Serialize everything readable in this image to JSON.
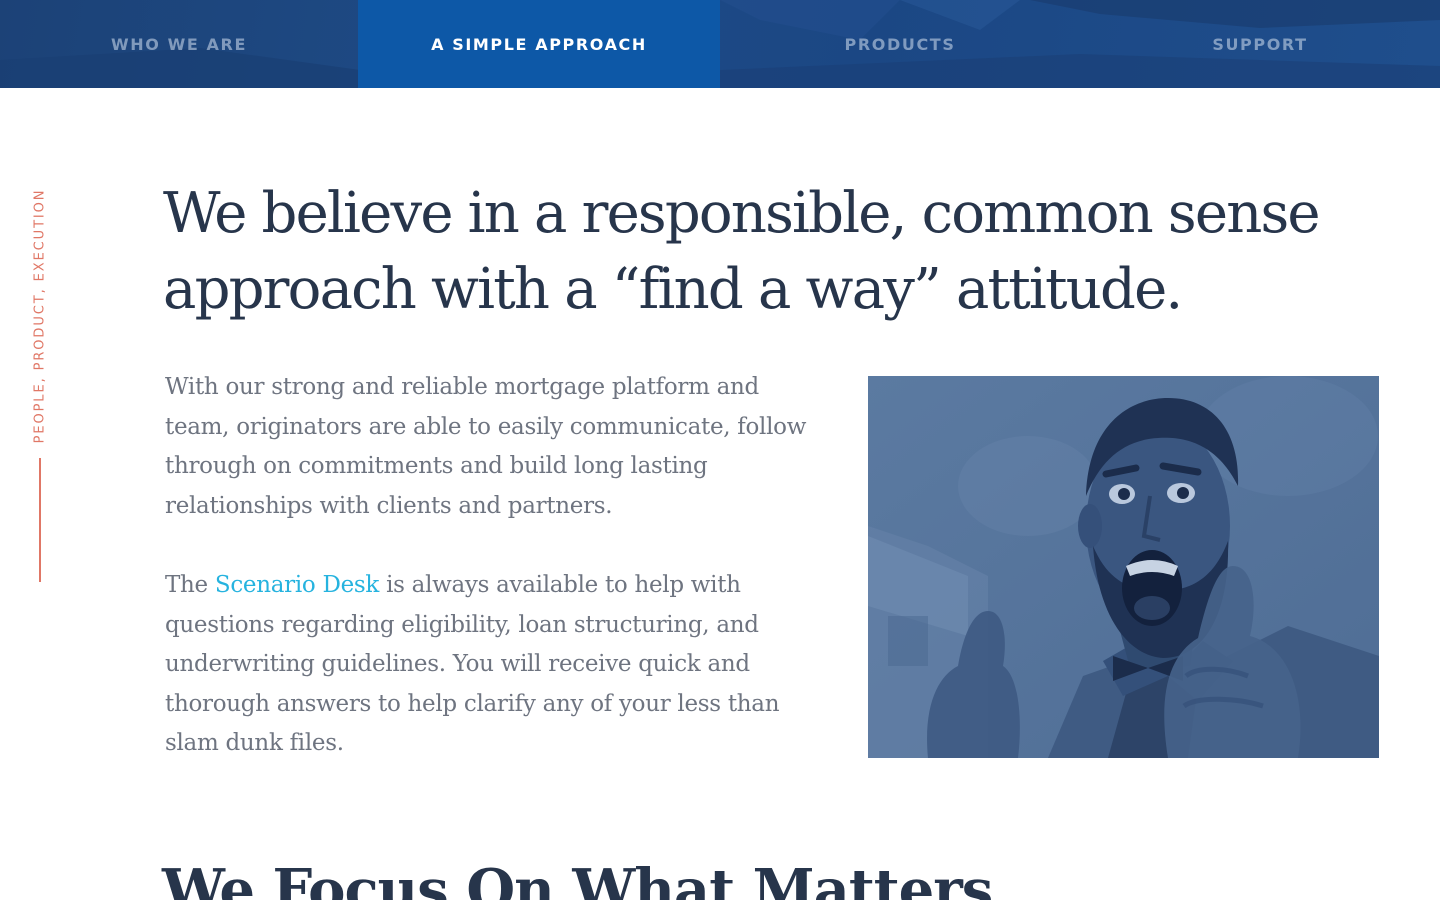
{
  "nav": {
    "items": [
      {
        "label": "WHO WE ARE"
      },
      {
        "label": "A SIMPLE APPROACH",
        "active": true
      },
      {
        "label": "PRODUCTS"
      },
      {
        "label": "SUPPORT"
      }
    ]
  },
  "side_label": "PEOPLE, PRODUCT, EXECUTION",
  "headline": "We believe in a responsible, common sense approach with a “find a way” attitude.",
  "paragraph_1": "With our strong and reliable mortgage platform and team, originators are able to easily communicate, follow through on commitments and build long lasting relationships with clients and partners.",
  "paragraph_2": {
    "prefix": "The ",
    "link": "Scenario Desk",
    "suffix": " is always available to help with questions regarding eligibility, loan structuring, and underwriting guidelines. You will receive quick and thorough answers to help clarify any of your less than slam dunk files."
  },
  "section_heading": "We Focus On What Matters",
  "colors": {
    "nav_background": "#1c4277",
    "nav_active": "#0d58a7",
    "headline": "#27354b",
    "body_text": "#6e7480",
    "link": "#26b3df",
    "side_accent": "#e07766",
    "photo_tint": "#56749b"
  },
  "photo": {
    "subject": "excited man with beard giving two thumbs up, blue duotone"
  }
}
